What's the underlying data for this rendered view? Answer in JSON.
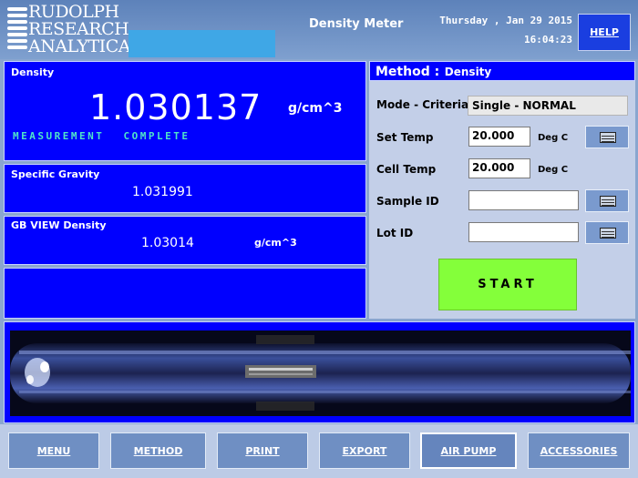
{
  "header": {
    "logo_lines": [
      "RUDOLPH",
      "RESEARCH",
      "ANALYTICAL"
    ],
    "title": "Density Meter",
    "date": "Thursday , Jan 29 2015",
    "time": "16:04:23",
    "help_label": "HELP"
  },
  "density_panel": {
    "title": "Density",
    "value": "1.030137",
    "unit": "g/cm^3",
    "status": "MEASUREMENT COMPLETE"
  },
  "sg_panel": {
    "title": "Specific Gravity",
    "value": "1.031991"
  },
  "gb_panel": {
    "title": "GB VIEW Density",
    "value": "1.03014",
    "unit": "g/cm^3"
  },
  "method": {
    "header_label": "Method :",
    "header_value": "Density",
    "mode_label": "Mode - Criteria",
    "mode_value": "Single - NORMAL",
    "set_temp_label": "Set Temp",
    "set_temp_value": "20.000",
    "set_temp_unit": "Deg C",
    "cell_temp_label": "Cell Temp",
    "cell_temp_value": "20.000",
    "cell_temp_unit": "Deg C",
    "sample_id_label": "Sample ID",
    "sample_id_value": "",
    "lot_id_label": "Lot ID",
    "lot_id_value": "",
    "start_label": "START"
  },
  "nav": [
    {
      "label": "MENU"
    },
    {
      "label": "METHOD"
    },
    {
      "label": "PRINT"
    },
    {
      "label": "EXPORT"
    },
    {
      "label": "AIR PUMP"
    },
    {
      "label": "ACCESSORIES"
    }
  ],
  "colors": {
    "panel_blue": "#0000ff",
    "start_green": "#84ff3a",
    "status_cyan": "#4fe3c9",
    "nav_button": "#6f8fc3"
  },
  "icons": [
    "keyboard-icon",
    "logo-mark-icon"
  ]
}
